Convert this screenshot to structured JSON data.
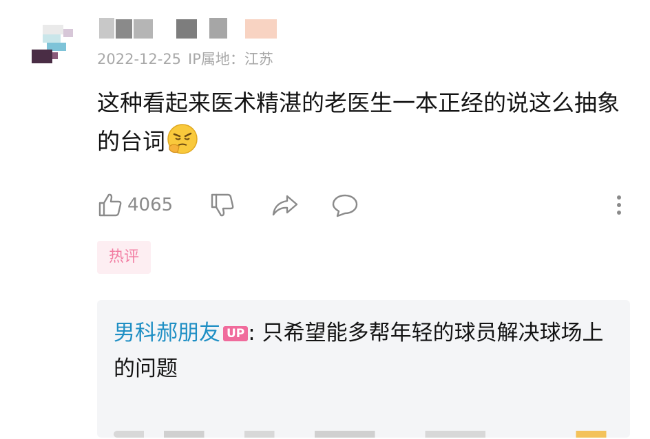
{
  "comment": {
    "date": "2022-12-25",
    "ip_location": "IP属地：江苏",
    "text": "这种看起来医术精湛的老医生一本正经的说这么抽象的台词",
    "emoji": "thinking-face-emoji",
    "like_count": "4065"
  },
  "tag": {
    "label": "热评"
  },
  "reply": {
    "author": "男科郝朋友",
    "badge": "UP",
    "text": ": 只希望能多帮年轻的球员解决球场上的问题"
  },
  "colors": {
    "author": "#1f8fc4",
    "up_badge": "#f06b9c",
    "tag_text": "#f27ea3",
    "tag_bg": "#fdeef2",
    "reply_bg": "#f4f5f7"
  },
  "icons": [
    "like-icon",
    "dislike-icon",
    "share-icon",
    "reply-icon",
    "more-icon"
  ]
}
